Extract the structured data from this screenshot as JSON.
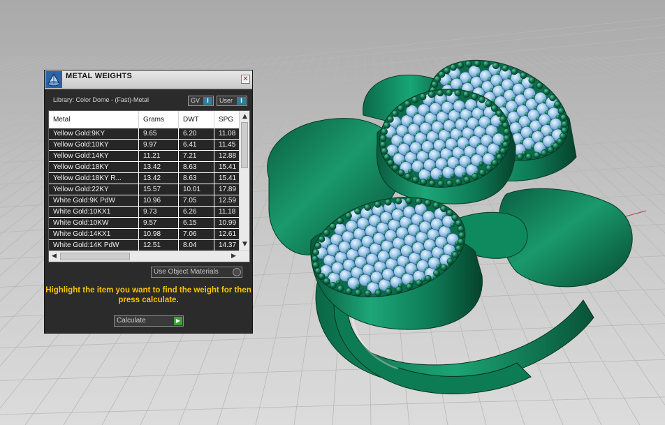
{
  "panel": {
    "title": "METAL WEIGHTS",
    "close_glyph": "✕",
    "library_label": "Library: Color Dome - (Fast)-Metal",
    "toggles": [
      {
        "label": "GV",
        "indicator": "I"
      },
      {
        "label": "User",
        "indicator": "I"
      }
    ],
    "columns": [
      "Metal",
      "Grams",
      "DWT",
      "SPG"
    ],
    "rows": [
      [
        "Yellow Gold:9KY",
        "9.65",
        "6.20",
        "11.08"
      ],
      [
        "Yellow Gold:10KY",
        "9.97",
        "6.41",
        "11.45"
      ],
      [
        "Yellow Gold:14KY",
        "11.21",
        "7.21",
        "12.88"
      ],
      [
        "Yellow Gold:18KY",
        "13.42",
        "8.63",
        "15.41"
      ],
      [
        "Yellow Gold:18KY R...",
        "13.42",
        "8.63",
        "15.41"
      ],
      [
        "Yellow Gold:22KY",
        "15.57",
        "10.01",
        "17.89"
      ],
      [
        "White Gold:9K PdW",
        "10.96",
        "7.05",
        "12.59"
      ],
      [
        "White Gold:10KX1",
        "9.73",
        "6.26",
        "11.18"
      ],
      [
        "White Gold:10KW",
        "9.57",
        "6.15",
        "10.99"
      ],
      [
        "White Gold:14KX1",
        "10.98",
        "7.06",
        "12.61"
      ],
      [
        "White Gold:14K PdW",
        "12.51",
        "8.04",
        "14.37"
      ]
    ],
    "materials_dropdown": "Use Object Materials",
    "instructions": "Highlight the item you want to find the weight for then press calculate.",
    "calculate_label": "Calculate"
  },
  "colors": {
    "panel_bg": "#2b2b2b",
    "row_bg": "#262626",
    "instruction_text": "#f6c400",
    "ring_metal": "#0c7a55",
    "gem_blue": "#9fc9ea",
    "viewport_bg": "#cfcfcf",
    "toggle_indicator": "#2f7f9a",
    "calculate_arrow": "#3da03a"
  },
  "icons": {
    "app_icon": "dome-gem-icon",
    "close": "close-icon",
    "scroll_up": "arrow-up-icon",
    "scroll_down": "arrow-down-icon",
    "scroll_left": "arrow-left-icon",
    "scroll_right": "arrow-right-icon",
    "calculate": "play-arrow-icon"
  }
}
